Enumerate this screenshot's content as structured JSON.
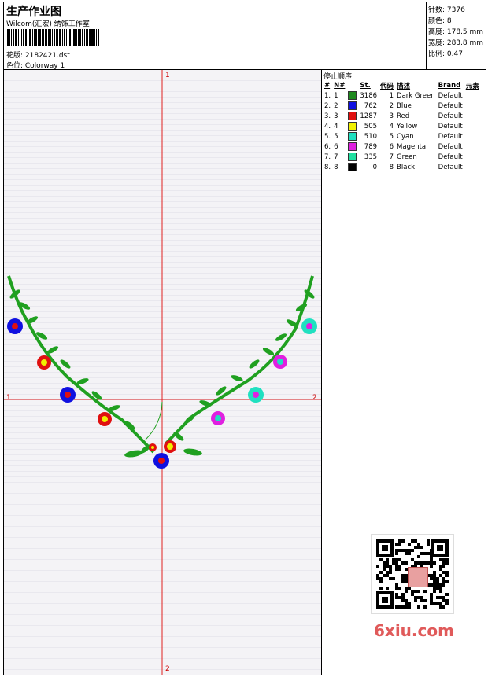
{
  "header": {
    "title": "生产作业图",
    "company": "Wilcom(汇宏) 绣饰工作室",
    "design_line": "花版: 2182421.dst",
    "colorway_line": "色位: Colorway 1"
  },
  "stats": [
    "针数: 7376",
    "颜色: 8",
    "高度: 178.5 mm",
    "宽度: 283.8 mm",
    "比例: 0.47"
  ],
  "stop_sequence": {
    "title": "停止顺序:",
    "headers": [
      "#",
      "N#",
      "St.",
      "代码",
      "描述",
      "Brand",
      "元素"
    ],
    "rows": [
      {
        "idx": "1.",
        "n": "1",
        "st": "3186",
        "code": "1",
        "desc": "Dark Green",
        "brand": "Default",
        "color": "#1e8a1e"
      },
      {
        "idx": "2.",
        "n": "2",
        "st": "762",
        "code": "2",
        "desc": "Blue",
        "brand": "Default",
        "color": "#1010e0"
      },
      {
        "idx": "3.",
        "n": "3",
        "st": "1287",
        "code": "3",
        "desc": "Red",
        "brand": "Default",
        "color": "#e01010"
      },
      {
        "idx": "4.",
        "n": "4",
        "st": "505",
        "code": "4",
        "desc": "Yellow",
        "brand": "Default",
        "color": "#f0f000"
      },
      {
        "idx": "5.",
        "n": "5",
        "st": "510",
        "code": "5",
        "desc": "Cyan",
        "brand": "Default",
        "color": "#20e0c0"
      },
      {
        "idx": "6.",
        "n": "6",
        "st": "789",
        "code": "6",
        "desc": "Magenta",
        "brand": "Default",
        "color": "#e020e0"
      },
      {
        "idx": "7.",
        "n": "7",
        "st": "335",
        "code": "7",
        "desc": "Green",
        "brand": "Default",
        "color": "#20e0a0"
      },
      {
        "idx": "8.",
        "n": "8",
        "st": "0",
        "code": "8",
        "desc": "Black",
        "brand": "Default",
        "color": "#000000"
      }
    ]
  },
  "axis_labels": {
    "top": "1",
    "bottom": "2",
    "left": "1",
    "right": "2"
  },
  "watermark": "6xiu.com"
}
